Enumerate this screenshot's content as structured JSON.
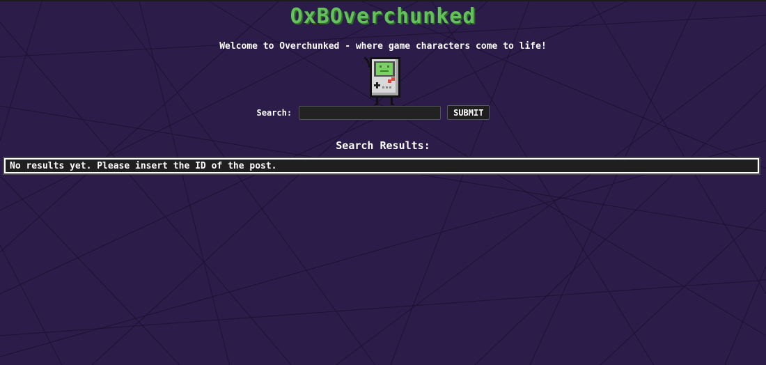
{
  "header": {
    "title": "OxBOverchunked",
    "welcome": "Welcome to Overchunked - where game characters come to life!",
    "mascot_icon": "gameboy-character-icon"
  },
  "search": {
    "label": "Search:",
    "value": "",
    "placeholder": "",
    "submit_label": "SUBMIT"
  },
  "results": {
    "heading": "Search Results:",
    "message": "No results yet. Please insert the ID of the post."
  },
  "colors": {
    "background": "#2b1c4a",
    "title_green": "#63c25a",
    "text": "#ffffff",
    "box_bg": "#1f1f1f"
  }
}
